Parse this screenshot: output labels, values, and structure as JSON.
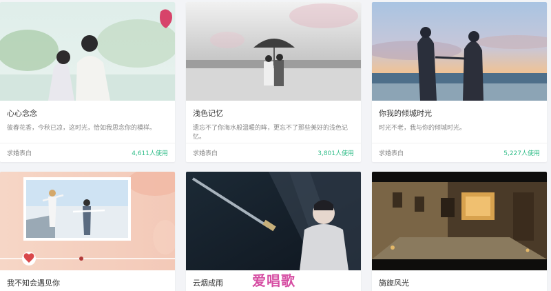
{
  "cards": [
    {
      "title": "心心念念",
      "desc": "彼春花香，今秋已凉，这时光，恰如我思念你的模样。",
      "category": "求婚表白",
      "uses": "4,611人使用"
    },
    {
      "title": "浅色记忆",
      "desc": "遗忘不了你海水般温暖的眸，更忘不了那些美好的浅色记忆。",
      "category": "求婚表白",
      "uses": "3,801人使用"
    },
    {
      "title": "你我的倾城时光",
      "desc": "时光不老，我与你的倾城时光。",
      "category": "求婚表白",
      "uses": "5,227人使用"
    },
    {
      "title": "我不知会遇见你"
    },
    {
      "title": "云烟成雨"
    },
    {
      "title": "旖旎风光"
    }
  ],
  "watermark": "爱唱歌",
  "colors": {
    "accent_green": "#2ebc87",
    "heart_red": "#d9474a"
  },
  "icons": {
    "heart": "heart-icon"
  }
}
